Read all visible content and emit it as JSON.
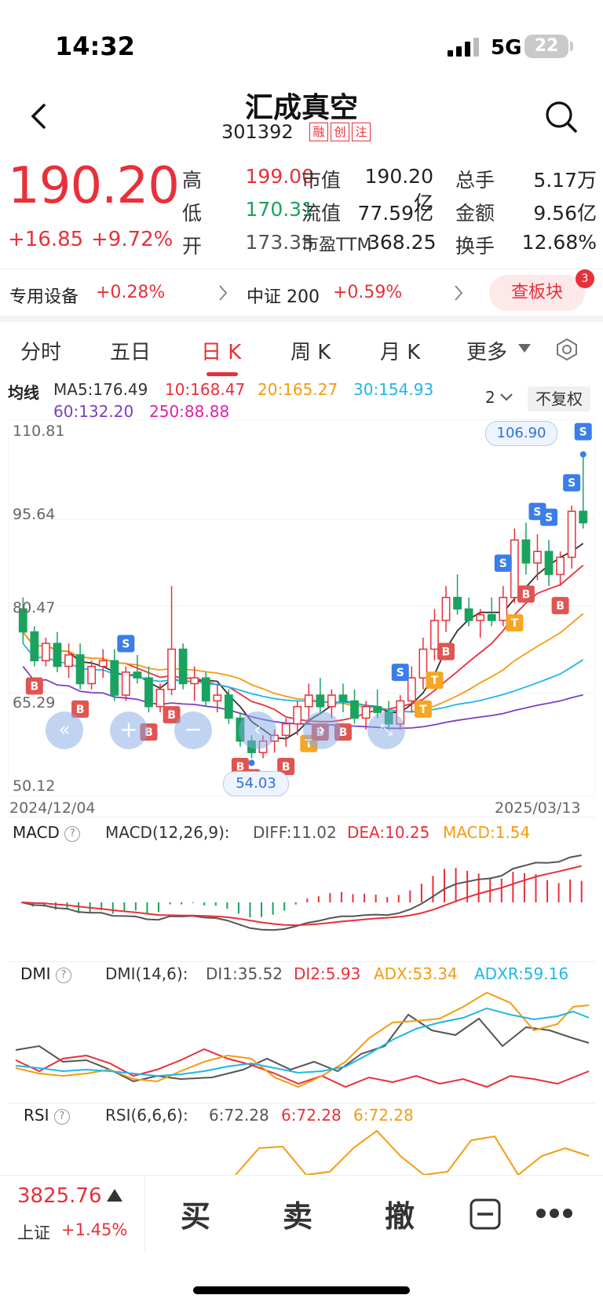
{
  "status": {
    "time": "14:32",
    "network": "5G",
    "battery": "22"
  },
  "header": {
    "name": "汇成真空",
    "code": "301392",
    "tags": [
      "融",
      "创",
      "注"
    ]
  },
  "quote": {
    "price": "190.20",
    "change": "+16.85",
    "change_pct": "+9.72%",
    "rows": [
      [
        {
          "label": "高",
          "value": "199.00"
        },
        {
          "label": "市值",
          "value": "190.20亿"
        },
        {
          "label": "总手",
          "value": "5.17万"
        }
      ],
      [
        {
          "label": "低",
          "value": "170.31"
        },
        {
          "label": "流值",
          "value": "77.59亿"
        },
        {
          "label": "金额",
          "value": "9.56亿"
        }
      ],
      [
        {
          "label": "开",
          "value": "173.35"
        },
        {
          "label": "市盈TTM",
          "value": "368.25"
        },
        {
          "label": "换手",
          "value": "12.68%"
        }
      ]
    ]
  },
  "sector": {
    "name": "专用设备",
    "pct": "+0.28%",
    "index_name": "中证 200",
    "index_pct": "+0.59%",
    "board_btn": "查板块",
    "badge": "3"
  },
  "tabs": [
    "分时",
    "五日",
    "日 K",
    "周 K",
    "月 K",
    "更多"
  ],
  "ma": {
    "label": "均线",
    "ma5": "MA5:176.49",
    "ma10": "10:168.47",
    "ma20": "20:165.27",
    "ma30": "30:154.93",
    "ma60": "60:132.20",
    "ma250": "250:88.88",
    "period": "2",
    "fq": "不复权"
  },
  "chart_data": {
    "type": "candlestick",
    "y_ticks": [
      "110.81",
      "95.64",
      "80.47",
      "65.29",
      "50.12"
    ],
    "x_labels": [
      "2024/12/04",
      "2025/03/13"
    ],
    "ylim": [
      50.12,
      110.81
    ],
    "high_label": "106.90",
    "low_label": "54.03",
    "candles": [
      [
        80,
        82,
        74,
        76
      ],
      [
        76,
        77,
        70,
        71
      ],
      [
        71,
        75,
        70,
        74
      ],
      [
        74,
        76,
        69,
        70
      ],
      [
        70,
        74,
        68,
        72
      ],
      [
        72,
        74,
        66,
        67
      ],
      [
        67,
        71,
        66,
        70
      ],
      [
        70,
        73,
        68,
        71
      ],
      [
        71,
        73,
        64,
        65
      ],
      [
        65,
        70,
        64,
        69
      ],
      [
        69,
        72,
        67,
        68
      ],
      [
        68,
        70,
        62,
        63
      ],
      [
        63,
        67,
        62,
        66
      ],
      [
        66,
        84,
        65,
        73
      ],
      [
        73,
        74,
        66,
        67
      ],
      [
        67,
        70,
        64,
        68
      ],
      [
        68,
        69,
        63,
        64
      ],
      [
        64,
        67,
        62,
        65
      ],
      [
        65,
        66,
        60,
        61
      ],
      [
        61,
        62,
        56,
        57
      ],
      [
        57,
        58,
        54.03,
        55
      ],
      [
        55,
        58,
        54,
        57
      ],
      [
        57,
        59,
        55,
        58
      ],
      [
        58,
        61,
        56,
        60
      ],
      [
        60,
        64,
        58,
        63
      ],
      [
        63,
        67,
        60,
        65
      ],
      [
        65,
        68,
        62,
        63
      ],
      [
        63,
        66,
        61,
        65
      ],
      [
        65,
        67,
        62,
        64
      ],
      [
        64,
        66,
        60,
        61
      ],
      [
        61,
        64,
        59,
        63
      ],
      [
        63,
        66,
        61,
        62
      ],
      [
        62,
        64,
        59,
        60
      ],
      [
        60,
        65,
        59,
        64
      ],
      [
        64,
        70,
        62,
        68
      ],
      [
        68,
        75,
        66,
        73
      ],
      [
        73,
        80,
        71,
        78
      ],
      [
        78,
        84,
        76,
        82
      ],
      [
        82,
        86,
        79,
        80
      ],
      [
        80,
        82,
        77,
        78
      ],
      [
        78,
        80,
        75,
        79
      ],
      [
        79,
        82,
        77,
        78
      ],
      [
        78,
        84,
        77,
        82
      ],
      [
        82,
        94,
        81,
        92
      ],
      [
        92,
        95,
        86,
        88
      ],
      [
        88,
        93,
        85,
        90
      ],
      [
        90,
        92,
        84,
        86
      ],
      [
        86,
        90,
        84,
        89
      ],
      [
        89,
        98,
        87,
        97
      ],
      [
        97,
        106.9,
        94,
        95
      ]
    ],
    "markers": [
      {
        "i": 1,
        "t": "B"
      },
      {
        "i": 5,
        "t": "B"
      },
      {
        "i": 9,
        "t": "S"
      },
      {
        "i": 11,
        "t": "B"
      },
      {
        "i": 13,
        "t": "B"
      },
      {
        "i": 19,
        "t": "B"
      },
      {
        "i": 20,
        "t": "B"
      },
      {
        "i": 23,
        "t": "B"
      },
      {
        "i": 25,
        "t": "T"
      },
      {
        "i": 26,
        "t": "B"
      },
      {
        "i": 28,
        "t": "B"
      },
      {
        "i": 33,
        "t": "S"
      },
      {
        "i": 35,
        "t": "T"
      },
      {
        "i": 36,
        "t": "T"
      },
      {
        "i": 37,
        "t": "B"
      },
      {
        "i": 42,
        "t": "S"
      },
      {
        "i": 43,
        "t": "T"
      },
      {
        "i": 44,
        "t": "B"
      },
      {
        "i": 45,
        "t": "S"
      },
      {
        "i": 46,
        "t": "S"
      },
      {
        "i": 47,
        "t": "B"
      },
      {
        "i": 48,
        "t": "S"
      },
      {
        "i": 49,
        "t": "S"
      }
    ],
    "ma_colors": {
      "ma5": "#333333",
      "ma10": "#e8303a",
      "ma20": "#f39c12",
      "ma30": "#1fb6e8",
      "ma60": "#7b3fc4",
      "ma250": "#e020a8"
    }
  },
  "macd": {
    "title": "MACD",
    "params": "MACD(12,26,9):",
    "diff": "DIFF:11.02",
    "dea": "DEA:10.25",
    "macd": "MACD:1.54"
  },
  "dmi": {
    "title": "DMI",
    "params": "DMI(14,6):",
    "di1": "DI1:35.52",
    "di2": "DI2:5.93",
    "adx": "ADX:53.34",
    "adxr": "ADXR:59.16"
  },
  "rsi": {
    "title": "RSI",
    "params": "RSI(6,6,6):",
    "r1": "6:72.28",
    "r2": "6:72.28",
    "r3": "6:72.28"
  },
  "bottom": {
    "index_value": "3825.76",
    "index_name": "上证",
    "index_pct": "+1.45%",
    "buy": "买",
    "sell": "卖",
    "cancel": "撤"
  }
}
